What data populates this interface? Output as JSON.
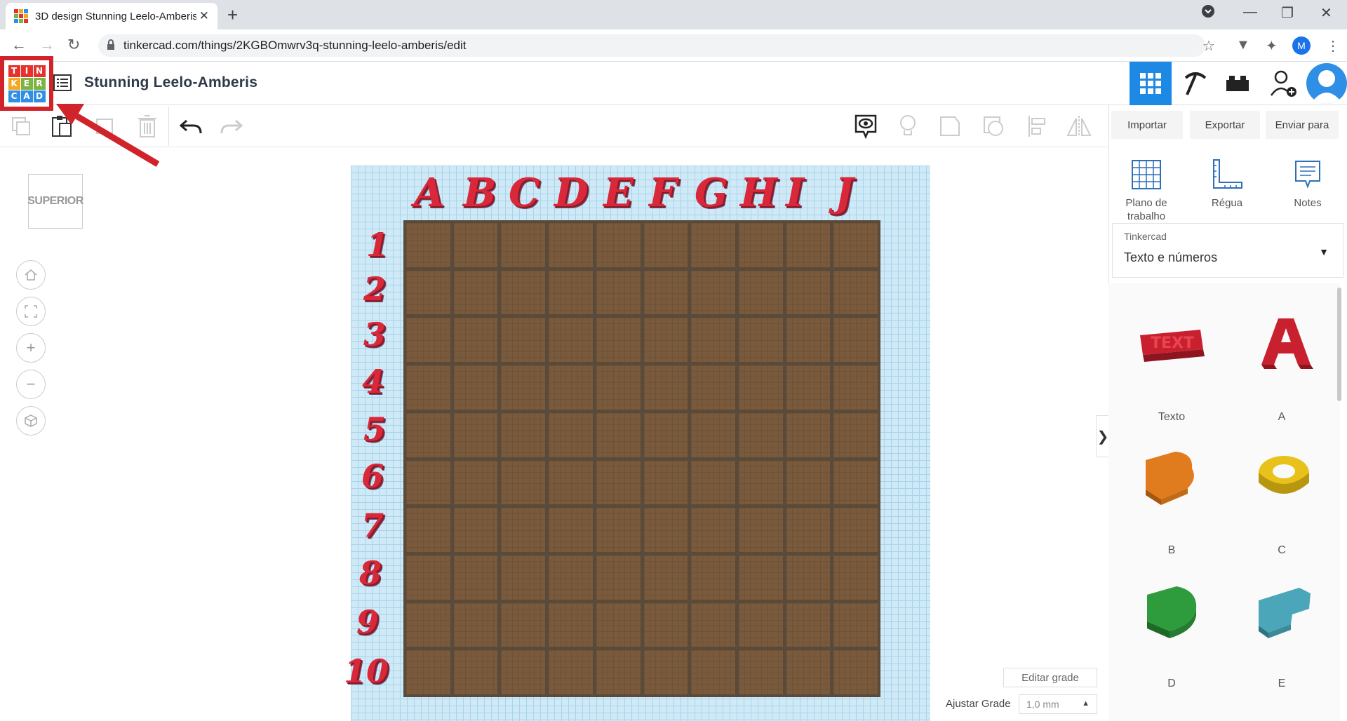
{
  "browser": {
    "tab_title": "3D design Stunning Leelo-Amberis",
    "url": "tinkercad.com/things/2KGBOmwrv3q-stunning-leelo-amberis/edit",
    "profile_initial": "M"
  },
  "app": {
    "logo_letters": [
      "T",
      "I",
      "N",
      "K",
      "E",
      "R",
      "C",
      "A",
      "D"
    ],
    "design_title": "Stunning Leelo-Amberis"
  },
  "toolbar": {
    "import_label": "Importar",
    "export_label": "Exportar",
    "send_label": "Enviar para"
  },
  "workplane": {
    "column_letters": [
      "A",
      "B",
      "C",
      "D",
      "E",
      "F",
      "G",
      "H",
      "I",
      "J"
    ],
    "row_numbers": [
      "1",
      "2",
      "3",
      "4",
      "5",
      "6",
      "7",
      "8",
      "9",
      "10"
    ],
    "view_cube_label": "SUPERIOR",
    "edit_grid_label": "Editar grade",
    "snap_grid_label": "Ajustar Grade",
    "snap_grid_value": "1,0 mm"
  },
  "panel": {
    "tools": [
      {
        "label": "Plano de trabalho",
        "icon": "workplane-icon"
      },
      {
        "label": "Régua",
        "icon": "ruler-icon"
      },
      {
        "label": "Notes",
        "icon": "notes-icon"
      }
    ],
    "library_provider": "Tinkercad",
    "library_name": "Texto e números",
    "shapes": [
      {
        "label": "Texto",
        "color": "#c8202e"
      },
      {
        "label": "A",
        "color": "#c8202e"
      },
      {
        "label": "B",
        "color": "#e07b1e"
      },
      {
        "label": "C",
        "color": "#e8c21a"
      },
      {
        "label": "D",
        "color": "#2e9c3c"
      },
      {
        "label": "E",
        "color": "#4aa6b8"
      }
    ]
  },
  "colors": {
    "accent": "#1e88e5",
    "highlight_red": "#d0232a",
    "letter_red": "#d8283a"
  }
}
